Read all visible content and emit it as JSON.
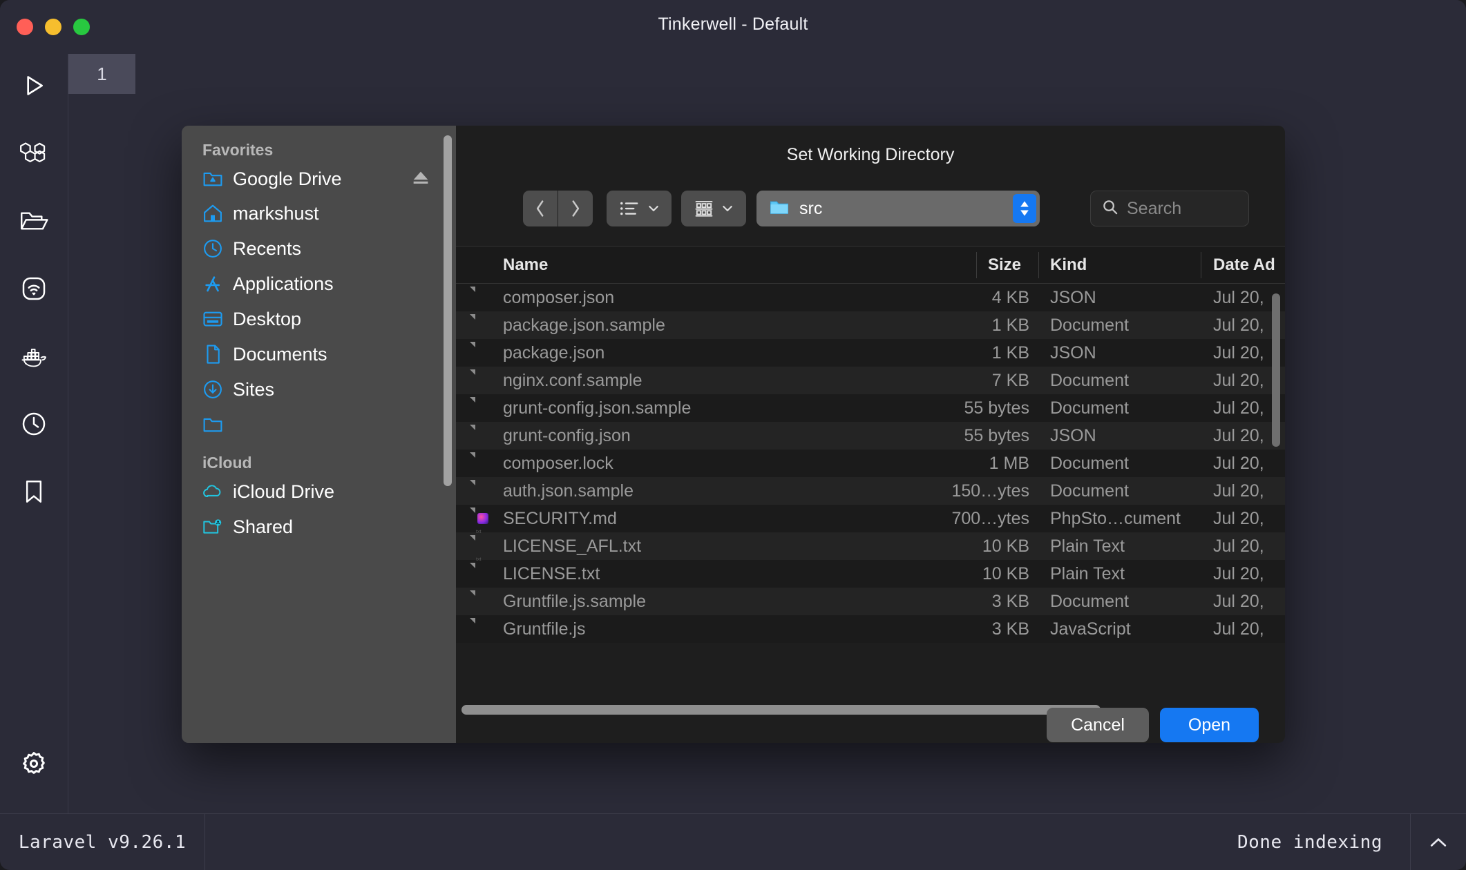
{
  "window": {
    "title": "Tinkerwell - Default",
    "traffic_lights": [
      "close",
      "minimize",
      "zoom"
    ]
  },
  "tabs": [
    {
      "label": "1"
    }
  ],
  "rail": {
    "items": [
      {
        "name": "run-icon",
        "label": "Run"
      },
      {
        "name": "laravel-icon",
        "label": "Laravel"
      },
      {
        "name": "folder-icon",
        "label": "Open Folder"
      },
      {
        "name": "ssh-icon",
        "label": "SSH Connection"
      },
      {
        "name": "docker-icon",
        "label": "Docker"
      },
      {
        "name": "history-icon",
        "label": "History"
      },
      {
        "name": "bookmark-icon",
        "label": "Snippets"
      }
    ],
    "settings": {
      "name": "gear-icon",
      "label": "Settings"
    }
  },
  "dialog": {
    "title": "Set Working Directory",
    "toolbar": {
      "back": "‹",
      "forward": "›",
      "view_mode": "list-view",
      "group_mode": "group-view",
      "path_value": "src",
      "search_placeholder": "Search"
    },
    "sidebar": {
      "sections": [
        {
          "title": "Favorites",
          "items": [
            {
              "label": "Google Drive",
              "icon": "google-drive-folder-icon",
              "eject": true
            },
            {
              "label": "markshust",
              "icon": "home-icon",
              "eject": false
            },
            {
              "label": "Recents",
              "icon": "clock-icon",
              "eject": false
            },
            {
              "label": "Applications",
              "icon": "applications-icon",
              "eject": false
            },
            {
              "label": "Desktop",
              "icon": "desktop-icon",
              "eject": false
            },
            {
              "label": "Documents",
              "icon": "document-icon",
              "eject": false
            },
            {
              "label": "Sites",
              "icon": "folder-icon",
              "eject": false
            }
          ]
        },
        {
          "title": "iCloud",
          "items": [
            {
              "label": "iCloud Drive",
              "icon": "cloud-icon",
              "eject": false
            },
            {
              "label": "Shared",
              "icon": "shared-folder-icon",
              "eject": false
            }
          ]
        }
      ]
    },
    "columns": [
      "Name",
      "Size",
      "Kind",
      "Date Ad"
    ],
    "files": [
      {
        "name": "composer.json",
        "size": "4 KB",
        "kind": "JSON",
        "date": "Jul 20,",
        "icon": "doc"
      },
      {
        "name": "package.json.sample",
        "size": "1 KB",
        "kind": "Document",
        "date": "Jul 20,",
        "icon": "doc"
      },
      {
        "name": "package.json",
        "size": "1 KB",
        "kind": "JSON",
        "date": "Jul 20,",
        "icon": "doc"
      },
      {
        "name": "nginx.conf.sample",
        "size": "7 KB",
        "kind": "Document",
        "date": "Jul 20,",
        "icon": "doc"
      },
      {
        "name": "grunt-config.json.sample",
        "size": "55 bytes",
        "kind": "Document",
        "date": "Jul 20,",
        "icon": "doc"
      },
      {
        "name": "grunt-config.json",
        "size": "55 bytes",
        "kind": "JSON",
        "date": "Jul 20,",
        "icon": "doc"
      },
      {
        "name": "composer.lock",
        "size": "1 MB",
        "kind": "Document",
        "date": "Jul 20,",
        "icon": "doc"
      },
      {
        "name": "auth.json.sample",
        "size": "150…ytes",
        "kind": "Document",
        "date": "Jul 20,",
        "icon": "doc"
      },
      {
        "name": "SECURITY.md",
        "size": "700…ytes",
        "kind": "PhpSto…cument",
        "date": "Jul 20,",
        "icon": "phpstorm"
      },
      {
        "name": "LICENSE_AFL.txt",
        "size": "10 KB",
        "kind": "Plain Text",
        "date": "Jul 20,",
        "icon": "txt"
      },
      {
        "name": "LICENSE.txt",
        "size": "10 KB",
        "kind": "Plain Text",
        "date": "Jul 20,",
        "icon": "txt"
      },
      {
        "name": "Gruntfile.js.sample",
        "size": "3 KB",
        "kind": "Document",
        "date": "Jul 20,",
        "icon": "doc"
      },
      {
        "name": "Gruntfile.js",
        "size": "3 KB",
        "kind": "JavaScript",
        "date": "Jul 20,",
        "icon": "doc"
      }
    ],
    "buttons": {
      "cancel": "Cancel",
      "open": "Open"
    }
  },
  "statusbar": {
    "left": "Laravel v9.26.1",
    "right": "Done indexing",
    "chevron": "⌃"
  },
  "colors": {
    "app_bg": "#2b2b38",
    "dialog_sidebar": "#4a4a4a",
    "dialog_main": "#1e1e1e",
    "accent_blue": "#1578f2",
    "sidebar_icon_blue": "#1d9bf0",
    "icloud_icon": "#22c5e0"
  }
}
